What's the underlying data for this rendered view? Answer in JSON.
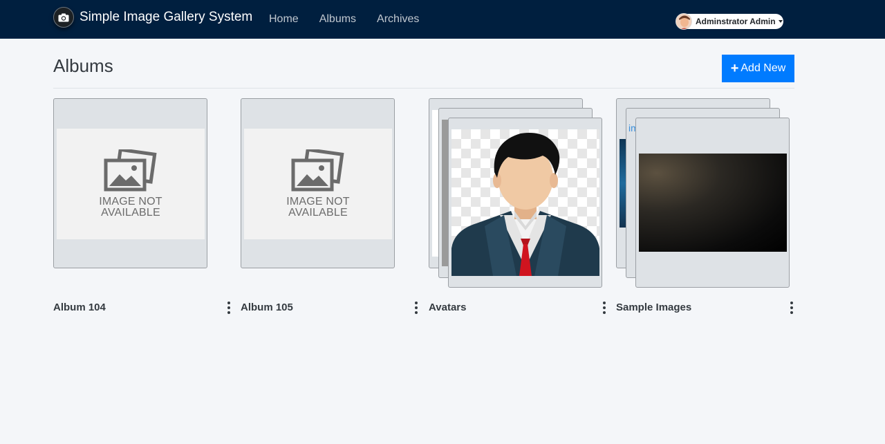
{
  "app": {
    "title": "Simple Image Gallery System"
  },
  "nav": {
    "links": [
      {
        "label": "Home"
      },
      {
        "label": "Albums"
      },
      {
        "label": "Archives"
      }
    ]
  },
  "user": {
    "name": "Adminstrator Admin"
  },
  "page": {
    "title": "Albums",
    "add_label": "Add New"
  },
  "albums": [
    {
      "name": "Album 104",
      "placeholder": "IMAGE NOT AVAILABLE"
    },
    {
      "name": "Album 105",
      "placeholder": "IMAGE NOT AVAILABLE"
    },
    {
      "name": "Avatars"
    },
    {
      "name": "Sample Images",
      "alt_text": "img"
    }
  ],
  "colors": {
    "navbar": "#001f3f",
    "primary": "#007bff",
    "background": "#f4f6f9"
  },
  "icons": {
    "logo": "camera-icon",
    "add": "plus-icon",
    "menu": "kebab-vertical-icon",
    "placeholder": "images-icon"
  }
}
